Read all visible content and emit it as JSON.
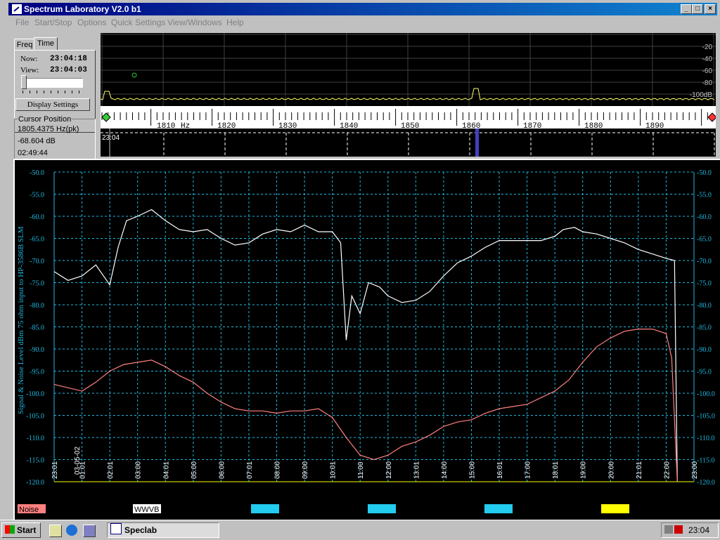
{
  "window": {
    "title": "Spectrum Laboratory V2.0 b1"
  },
  "menu": [
    "File",
    "Start/Stop",
    "Options",
    "Quick Settings",
    "View/Windows",
    "Help"
  ],
  "panel": {
    "tabs": [
      "Freq",
      "Time"
    ],
    "now_label": "Now:",
    "now_value": "23:04:18",
    "view_label": "View:",
    "view_value": "23:04:03",
    "display_settings": "Display Settings",
    "cursor_title": "Cursor Position",
    "cursor_freq": "1805.4375 Hz(pk)",
    "cursor_level": "-68.604 dB",
    "cursor_time": "02:49:44"
  },
  "spectrum": {
    "db_ticks": [
      "-20",
      "-40",
      "-60",
      "-80",
      "-100dB"
    ],
    "trace_color": "#ffff66"
  },
  "freq_scale": {
    "labels": [
      "1810",
      "1820",
      "1830",
      "1840",
      "1850",
      "1860",
      "1870",
      "1880",
      "1890"
    ],
    "unit": "Hz"
  },
  "waterfall": {
    "time_label": "23:04"
  },
  "chart_data": {
    "type": "line",
    "ylabel": "Signal & Noise Level dBm 75 ohm input to HP-3586B SLM",
    "ylim": [
      -120,
      -50
    ],
    "y_ticks": [
      "-50.0",
      "-55.0",
      "-60.0",
      "-65.0",
      "-70.0",
      "-75.0",
      "-80.0",
      "-85.0",
      "-90.0",
      "-95.0",
      "-100.0",
      "-105.0",
      "-110.0",
      "-115.0",
      "-120.0"
    ],
    "x_labels": [
      "23:01",
      "01:01",
      "02:01",
      "03:00",
      "04:01",
      "05:00",
      "06:00",
      "07:01",
      "08:00",
      "09:00",
      "10:01",
      "11:00",
      "12:00",
      "13:01",
      "14:00",
      "15:00",
      "16:01",
      "17:00",
      "18:01",
      "19:00",
      "20:00",
      "21:01",
      "22:00",
      "23:00"
    ],
    "date_label": "03-05-02",
    "series": [
      {
        "name": "WWVB",
        "color": "#ffffff",
        "x": [
          0,
          0.5,
          1,
          1.5,
          2,
          2.3,
          2.6,
          3,
          3.5,
          4,
          4.5,
          5,
          5.5,
          6,
          6.5,
          7,
          7.5,
          8,
          8.5,
          9,
          9.5,
          10,
          10.3,
          10.5,
          10.7,
          11,
          11.3,
          11.7,
          12,
          12.5,
          13,
          13.5,
          14,
          14.5,
          15,
          15.5,
          16,
          16.5,
          17,
          17.5,
          18,
          18.3,
          18.7,
          19,
          19.5,
          20,
          20.5,
          21,
          21.5,
          22,
          22.3,
          22.4
        ],
        "values": [
          -72.5,
          -74.5,
          -73.5,
          -71,
          -75.5,
          -67,
          -61,
          -60,
          -58.5,
          -61,
          -63,
          -63.5,
          -63,
          -65,
          -66.5,
          -66,
          -64,
          -63,
          -63.5,
          -62,
          -63.5,
          -63.5,
          -66,
          -88,
          -78,
          -82,
          -75,
          -76,
          -78,
          -79.5,
          -79,
          -77,
          -73.5,
          -70.5,
          -69,
          -67,
          -65.5,
          -65.5,
          -65.5,
          -65.5,
          -64.5,
          -63,
          -62.5,
          -63.5,
          -64,
          -65,
          -66,
          -67.5,
          -68.5,
          -69.5,
          -70,
          -120
        ]
      },
      {
        "name": "Noise",
        "color": "#ff8080",
        "x": [
          0,
          1,
          1.5,
          2,
          2.5,
          3,
          3.5,
          4,
          4.5,
          5,
          5.5,
          6,
          6.5,
          7,
          7.5,
          8,
          8.5,
          9,
          9.5,
          10,
          10.5,
          11,
          11.5,
          12,
          12.5,
          13,
          13.5,
          14,
          14.5,
          15,
          15.5,
          16,
          16.5,
          17,
          17.5,
          18,
          18.5,
          19,
          19.5,
          20,
          20.5,
          21,
          21.5,
          22,
          22.2,
          22.4
        ],
        "values": [
          -98,
          -99.5,
          -97.5,
          -95,
          -93.5,
          -93,
          -92.5,
          -94,
          -96,
          -97.5,
          -100,
          -102,
          -103.5,
          -104,
          -104,
          -104.5,
          -104,
          -104,
          -103.5,
          -105.5,
          -110,
          -114,
          -115,
          -114,
          -112,
          -111,
          -109.5,
          -107.5,
          -106.5,
          -106,
          -104.5,
          -103.5,
          -103,
          -102.5,
          -101,
          -99.5,
          -97,
          -93,
          -89.5,
          -87.5,
          -86,
          -85.5,
          -85.5,
          -86.5,
          -92,
          -120
        ]
      }
    ],
    "legend": [
      {
        "label": "Noise",
        "color": "#ff8080"
      },
      {
        "label": "WWVB",
        "color": "#ffffff"
      },
      {
        "label": "",
        "color": "#22ccee"
      },
      {
        "label": "",
        "color": "#22ccee"
      },
      {
        "label": "",
        "color": "#22ccee"
      },
      {
        "label": "",
        "color": "#ffff00"
      }
    ],
    "grid": true,
    "axis_color": "#20b8e0"
  },
  "taskbar": {
    "start": "Start",
    "task": "Speclab",
    "clock": "23:04"
  }
}
